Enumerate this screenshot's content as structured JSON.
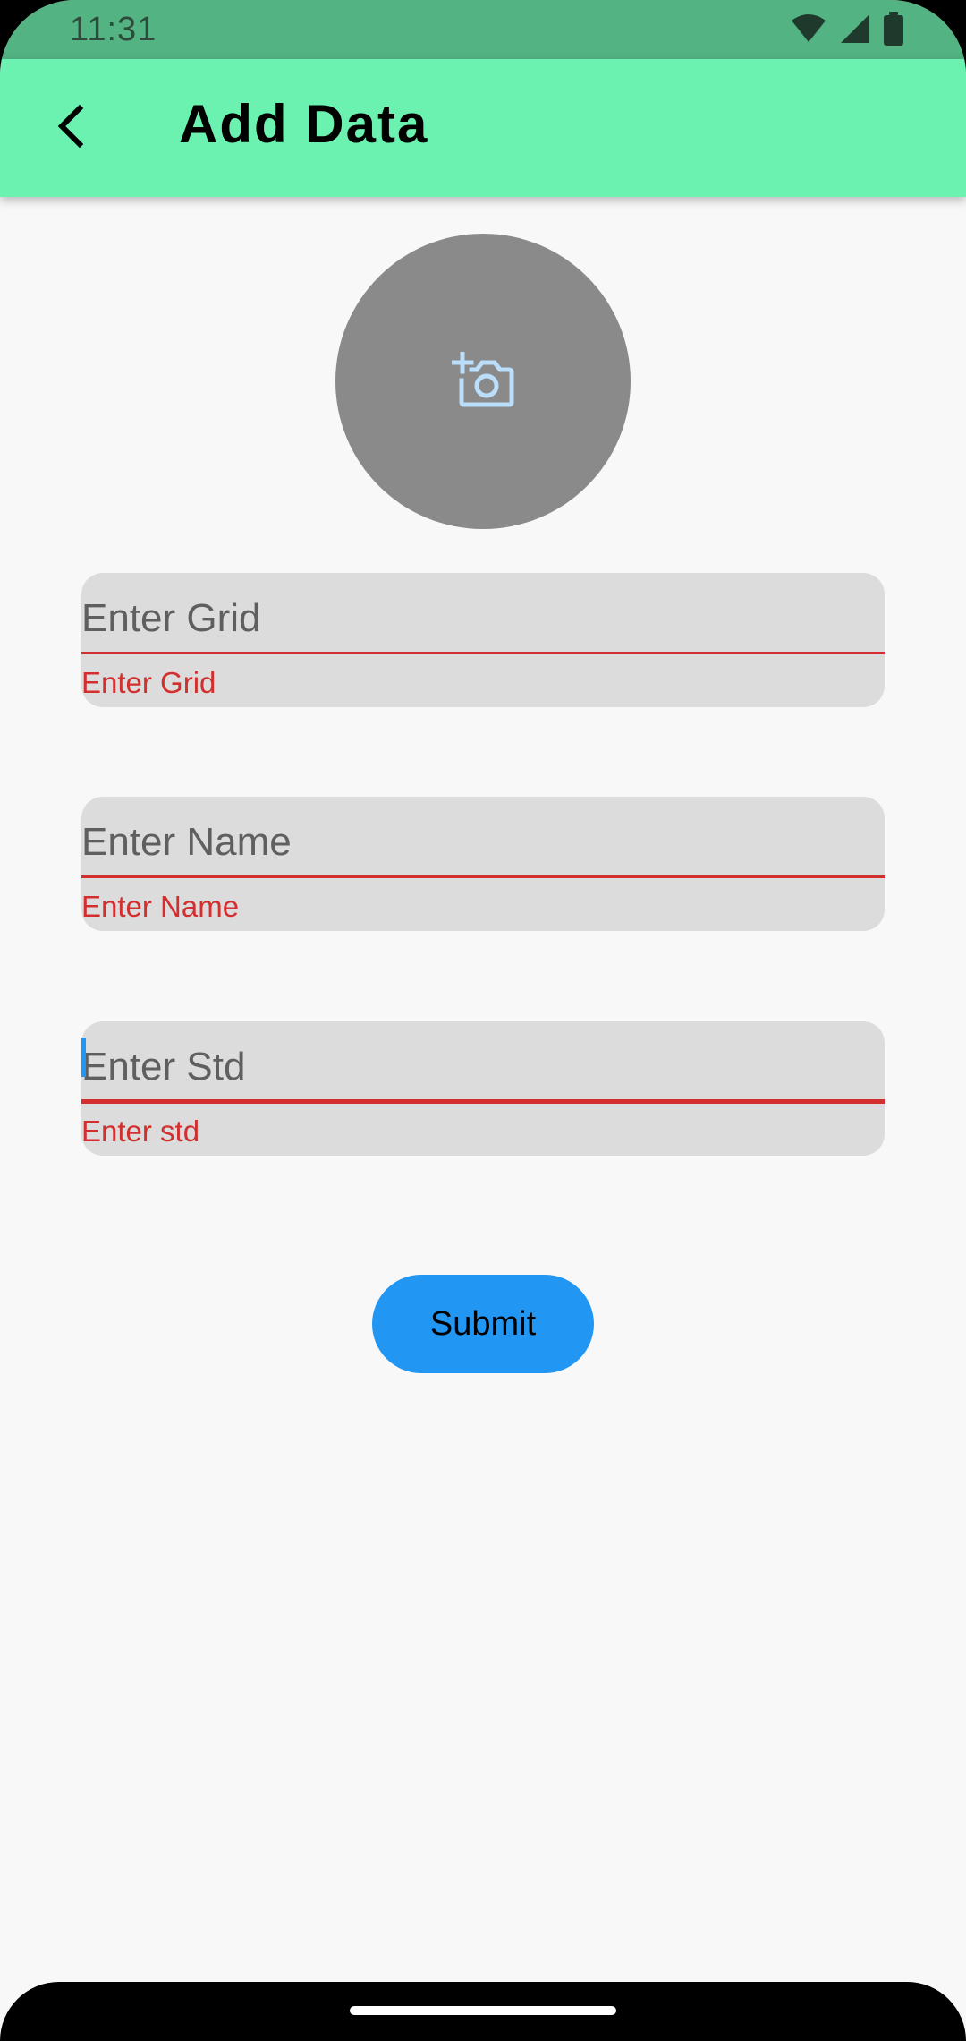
{
  "status_bar": {
    "time": "11:31",
    "icons": [
      "wifi-icon",
      "signal-icon",
      "battery-icon"
    ]
  },
  "app_bar": {
    "back_icon": "chevron-left-icon",
    "title": "Add Data",
    "background": "#6cf2b0"
  },
  "avatar": {
    "icon": "add-camera-icon",
    "background": "#8a8a8a",
    "icon_color": "#bbdefb"
  },
  "form": {
    "fields": [
      {
        "placeholder": "Enter Grid",
        "value": "",
        "error": "Enter Grid"
      },
      {
        "placeholder": "Enter Name",
        "value": "",
        "error": "Enter Name"
      },
      {
        "placeholder": "Enter Std",
        "value": "",
        "error": "Enter std",
        "focused": true
      }
    ],
    "error_color": "#d32f2f",
    "submit_label": "Submit",
    "submit_color": "#2196f3"
  }
}
